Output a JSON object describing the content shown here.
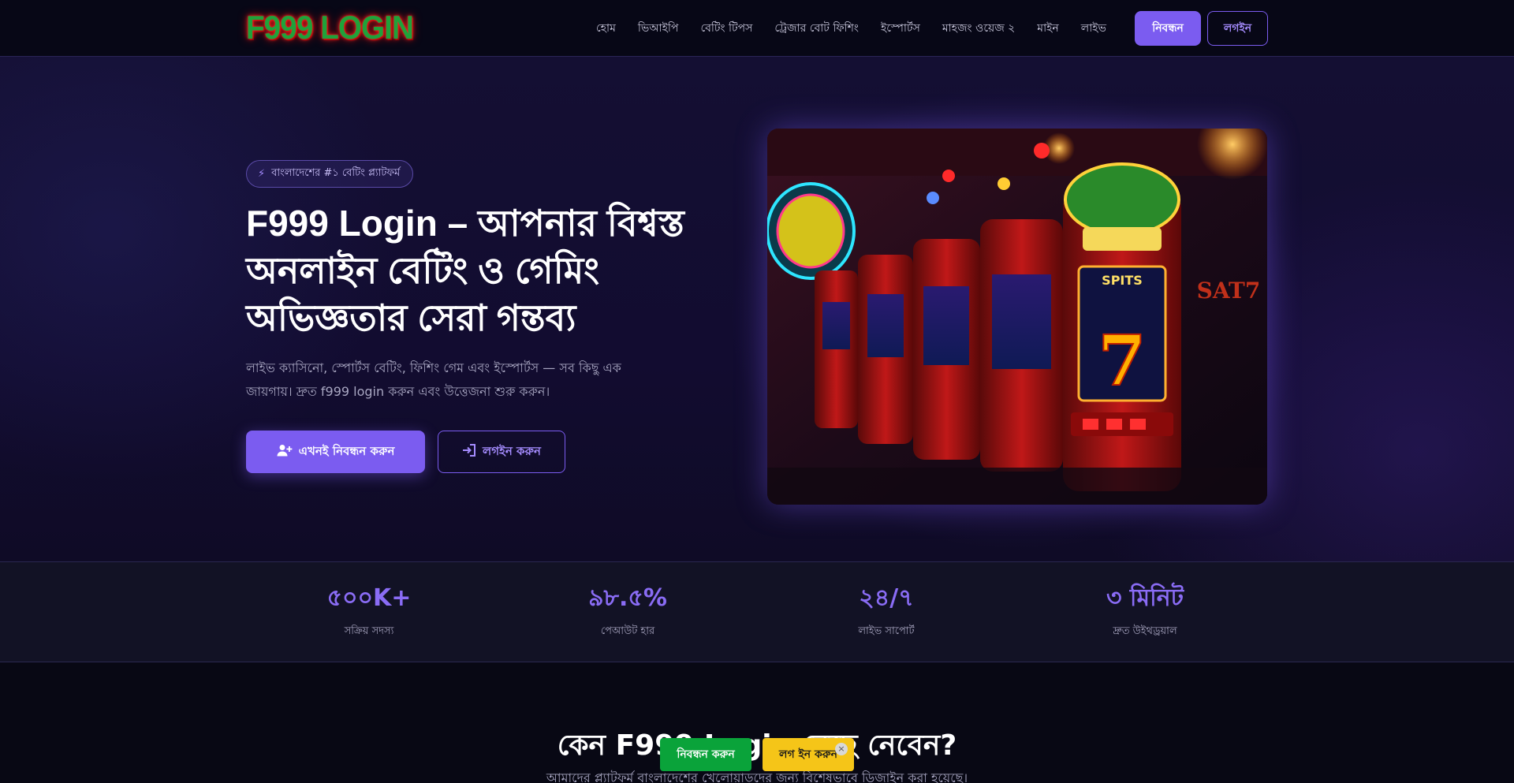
{
  "header": {
    "logo_text": "F999 LOGIN",
    "nav": [
      "হোম",
      "ভিআইপি",
      "বেটিং টিপস",
      "ট্রেজার বোট ফিশিং",
      "ইস্পোর্টস",
      "মাহজং ওয়েজ ২",
      "মাইন",
      "লাইভ"
    ],
    "register_label": "নিবন্ধন",
    "login_label": "লগইন"
  },
  "hero": {
    "badge": "বাংলাদেশের #১ বেটিং প্ল্যাটফর্ম",
    "title": "F999 Login – আপনার বিশ্বস্ত অনলাইন বেটিং ও গেমিং অভিজ্ঞতার সেরা গন্তব্য",
    "subtitle": "লাইভ ক্যাসিনো, স্পোর্টস বেটিং, ফিশিং গেম এবং ইস্পোর্টস — সব কিছু এক জায়গায়। দ্রুত f999 login করুন এবং উত্তেজনা শুরু করুন।",
    "primary_button": "এখনই নিবন্ধন করুন",
    "secondary_button": "লগইন করুন"
  },
  "stats": [
    {
      "value": "৫০০K+",
      "label": "সক্রিয় সদস্য"
    },
    {
      "value": "৯৮.৫%",
      "label": "পেআউট হার"
    },
    {
      "value": "২৪/৭",
      "label": "লাইভ সাপোর্ট"
    },
    {
      "value": "৩ মিনিট",
      "label": "দ্রুত উইথড্রয়াল"
    }
  ],
  "why": {
    "title": "কেন F999 Login বেছে নেবেন?",
    "subtitle": "আমাদের প্ল্যাটফর্ম বাংলাদেশের খেলোয়াড়দের জন্য বিশেষভাবে ডিজাইন করা হয়েছে।"
  },
  "floating": {
    "register": "নিবন্ধন করুন",
    "login": "লগ ইন করুন",
    "close": "×"
  },
  "image": {
    "slot_text_1": "7",
    "slot_text_2": "SAT7",
    "slot_text_3": "SPITS"
  }
}
